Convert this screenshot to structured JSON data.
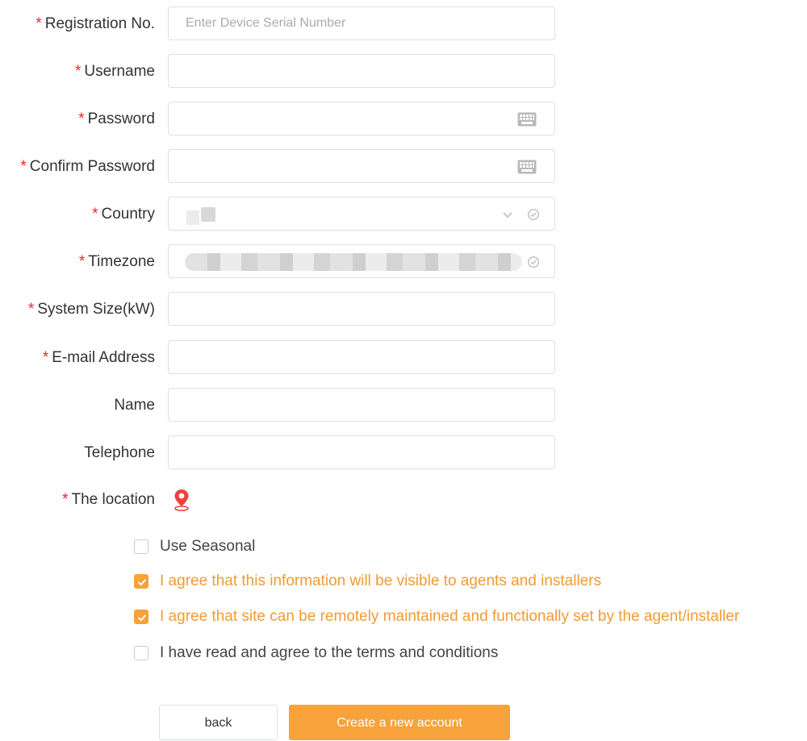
{
  "form": {
    "required_mark": "*",
    "registration": {
      "label": "Registration No.",
      "placeholder": "Enter Device Serial Number",
      "value": ""
    },
    "username": {
      "label": "Username",
      "value": ""
    },
    "password": {
      "label": "Password",
      "value": "",
      "icon": "keyboard-icon"
    },
    "confirm_password": {
      "label": "Confirm Password",
      "value": "",
      "icon": "keyboard-icon"
    },
    "country": {
      "label": "Country",
      "icons": [
        "chevron-down-icon",
        "check-circle-icon"
      ]
    },
    "timezone": {
      "label": "Timezone",
      "icons": [
        "check-circle-icon"
      ]
    },
    "system_size": {
      "label": "System Size(kW)",
      "value": ""
    },
    "email": {
      "label": "E-mail Address",
      "value": ""
    },
    "name": {
      "label": "Name",
      "value": ""
    },
    "telephone": {
      "label": "Telephone",
      "value": ""
    },
    "location": {
      "label": "The location",
      "icon": "map-pin-icon"
    }
  },
  "checkboxes": [
    {
      "label": "Use Seasonal",
      "checked": false
    },
    {
      "label": "I agree that this information will be visible to agents and installers",
      "checked": true
    },
    {
      "label": "I agree that site can be remotely maintained and functionally set by the agent/installer",
      "checked": true
    },
    {
      "label": "I have read and agree to the terms and conditions",
      "checked": false
    }
  ],
  "buttons": {
    "back": "back",
    "create": "Create a new account"
  },
  "colors": {
    "accent": "#f7a23b",
    "required": "#f5222d",
    "location_pin": "#f0423c",
    "checked_text": "#f29b32"
  }
}
